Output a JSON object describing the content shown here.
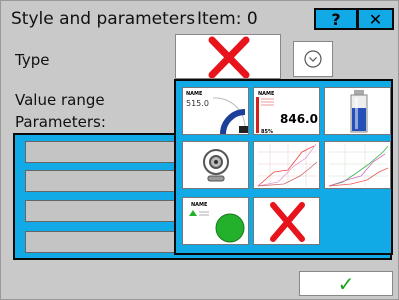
{
  "header": {
    "title": "Style and parameters",
    "item_label": "Item: 0",
    "help_label": "?",
    "close_label": "✕"
  },
  "form": {
    "type_label": "Type",
    "value_range_label": "Value range",
    "parameters_label": "Parameters:"
  },
  "style_tiles": [
    {
      "name": "gauge-style",
      "caption": "NAME",
      "value": "515.0"
    },
    {
      "name": "digital-display-style",
      "caption": "NAME",
      "value": "846.0",
      "percent": "85%"
    },
    {
      "name": "tank-level-style"
    },
    {
      "name": "webcam-style"
    },
    {
      "name": "line-chart-style"
    },
    {
      "name": "trend-chart-style"
    },
    {
      "name": "status-indicator-style",
      "caption": "NAME"
    },
    {
      "name": "none-style"
    }
  ],
  "colors": {
    "accent": "#11a9e6",
    "background": "#c9c9c9",
    "cross": "#e8141c",
    "ok_check": "#19a51a",
    "indicator_green": "#23b02a"
  },
  "footer": {
    "ok_label": "✓"
  }
}
